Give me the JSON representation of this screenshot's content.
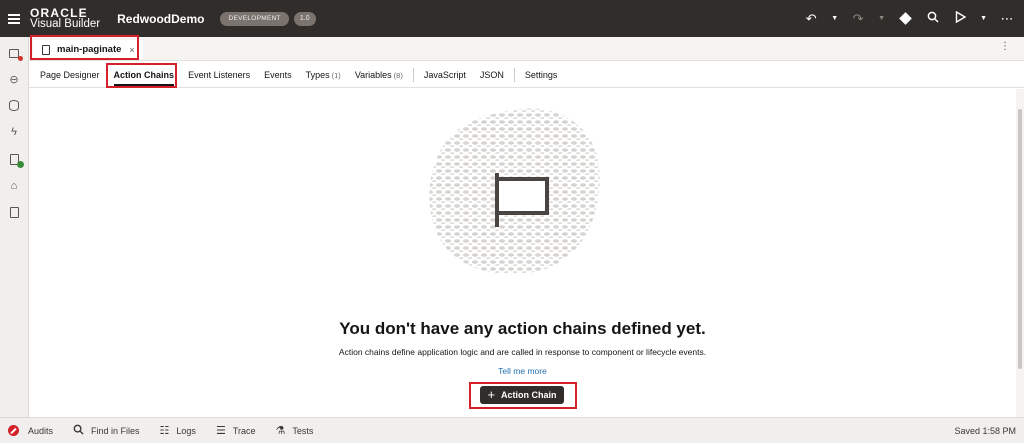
{
  "header": {
    "brand_top": "ORACLE",
    "brand_bottom": "Visual Builder",
    "app_name": "RedwoodDemo",
    "environment": "DEVELOPMENT",
    "version": "1.0",
    "icons": [
      "undo-icon",
      "redo-icon",
      "git-icon",
      "search-icon",
      "run-icon",
      "more-icon"
    ]
  },
  "left_nav": {
    "items": [
      "web-apps-icon",
      "services-icon",
      "business-objects-icon",
      "process-icon",
      "components-icon",
      "layouts-icon",
      "source-icon"
    ]
  },
  "file_tab": {
    "name": "main-paginate",
    "close": "×",
    "more": "⋮"
  },
  "tabs": [
    {
      "label": "Page Designer",
      "count": ""
    },
    {
      "label": "Action Chains",
      "count": ""
    },
    {
      "label": "Event Listeners",
      "count": ""
    },
    {
      "label": "Events",
      "count": ""
    },
    {
      "label": "Types",
      "count": "(1)"
    },
    {
      "label": "Variables",
      "count": "(8)"
    },
    {
      "label": "JavaScript",
      "count": ""
    },
    {
      "label": "JSON",
      "count": ""
    },
    {
      "label": "Settings",
      "count": ""
    }
  ],
  "empty_state": {
    "headline": "You don't have any action chains defined yet.",
    "description": "Action chains define application logic and are called in response to component or lifecycle events.",
    "link": "Tell me more",
    "button": "Action Chain"
  },
  "status_bar": {
    "audits": "Audits",
    "find": "Find in Files",
    "logs": "Logs",
    "trace": "Trace",
    "tests": "Tests",
    "saved": "Saved 1:58 PM"
  }
}
